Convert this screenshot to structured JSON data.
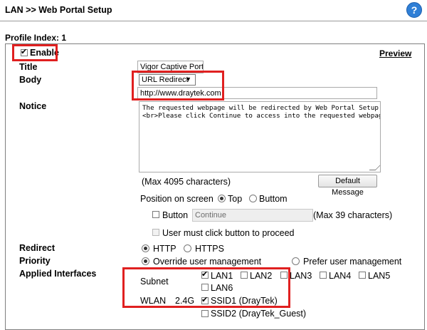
{
  "header": {
    "title": "LAN >> Web Portal Setup"
  },
  "profile_index_label": "Profile Index: 1",
  "enable": {
    "label": "Enable",
    "checked": true
  },
  "preview_link": "Preview",
  "title_row": {
    "label": "Title",
    "value": "Vigor Captive Portal"
  },
  "body_row": {
    "label": "Body",
    "select_value": "URL Redirect",
    "select_arrow": "▼",
    "url_value": "http://www.draytek.com"
  },
  "notice_row": {
    "label": "Notice",
    "text": "The requested webpage will be redirected by Web Portal Setup.\n<br>Please click Continue to access into the requested webpage.",
    "max_chars": "(Max 4095 characters)",
    "default_button": "Default Message"
  },
  "position": {
    "label": "Position on screen",
    "top": "Top",
    "bottom": "Buttom",
    "selected": "Top"
  },
  "button_row": {
    "label": "Button",
    "value": "Continue",
    "max_chars": "(Max 39 characters)",
    "must_click": "User must click button to proceed"
  },
  "redirect": {
    "label": "Redirect",
    "http": "HTTP",
    "https": "HTTPS",
    "selected": "HTTP"
  },
  "priority": {
    "label": "Priority",
    "override": "Override user management",
    "prefer": "Prefer user management",
    "selected": "override"
  },
  "interfaces": {
    "label": "Applied Interfaces",
    "subnet_label": "Subnet",
    "lans": [
      {
        "label": "LAN1",
        "checked": true
      },
      {
        "label": "LAN2",
        "checked": false
      },
      {
        "label": "LAN3",
        "checked": false
      },
      {
        "label": "LAN4",
        "checked": false
      },
      {
        "label": "LAN5",
        "checked": false
      },
      {
        "label": "LAN6",
        "checked": false
      }
    ],
    "wlan_label": "WLAN",
    "band": "2.4G",
    "ssids": [
      {
        "label": "SSID1 (DrayTek)",
        "checked": true
      },
      {
        "label": "SSID2 (DrayTek_Guest)",
        "checked": false
      }
    ]
  },
  "colors": {
    "highlight": "#e02020",
    "help_icon": "#2f7fd6"
  },
  "icons": {
    "help": "help-question-icon",
    "help_glyph": "?"
  }
}
